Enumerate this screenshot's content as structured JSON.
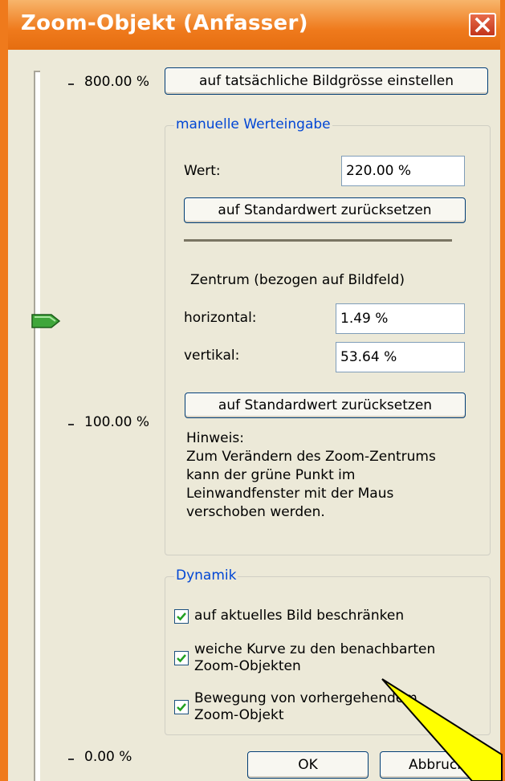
{
  "window": {
    "title": "Zoom-Objekt (Anfasser)",
    "close_icon": "close-icon"
  },
  "slider": {
    "max_label": "800.00 %",
    "mid_label": "100.00 %",
    "min_label": "0.00 %",
    "value_percent": 220.0
  },
  "actual_size_button": "auf tatsächliche Bildgrösse einstellen",
  "manual": {
    "group_label": "manuelle Werteingabe",
    "value_label": "Wert:",
    "value": "220.00 %",
    "reset_button": "auf Standardwert zurücksetzen"
  },
  "center": {
    "title": "Zentrum (bezogen auf Bildfeld)",
    "horizontal_label": "horizontal:",
    "horizontal_value": "1.49 %",
    "vertical_label": "vertikal:",
    "vertical_value": "53.64 %",
    "reset_button": "auf Standardwert zurücksetzen",
    "hint": "Hinweis:\nZum Verändern des Zoom-Zentrums\nkann der grüne Punkt  im\nLeinwandfenster mit der Maus\nverschoben werden."
  },
  "dynamics": {
    "group_label": "Dynamik",
    "options": [
      {
        "label": "auf aktuelles Bild beschränken",
        "checked": true
      },
      {
        "label": "weiche Kurve zu den benachbarten Zoom-Objekten",
        "checked": true
      },
      {
        "label": "Bewegung von vorhergehendem Zoom-Objekt",
        "checked": true
      }
    ]
  },
  "buttons": {
    "ok": "OK",
    "cancel": "Abbruch"
  },
  "colors": {
    "title_bar": "#ef7a1c",
    "accent_group_label": "#0046d5",
    "slider_thumb": "#3fa63a",
    "annotation_arrow": "#ffff00"
  }
}
